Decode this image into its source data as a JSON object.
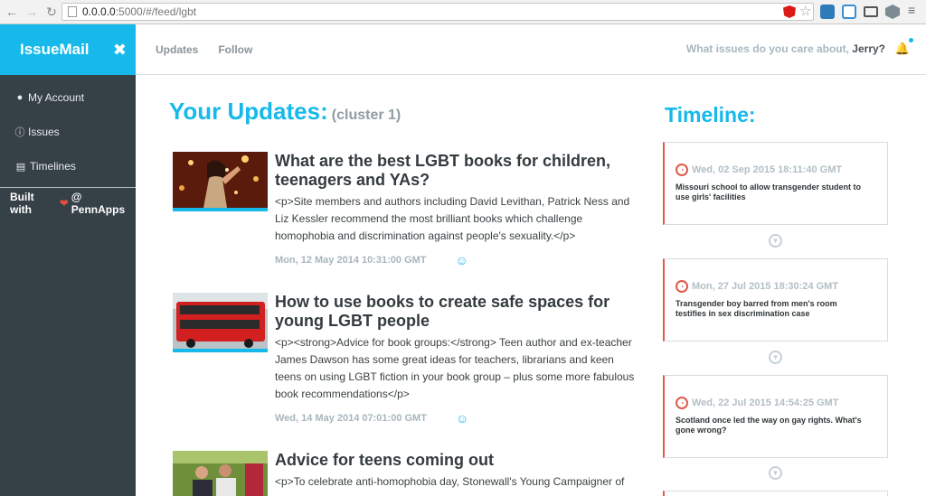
{
  "browser": {
    "url_host": "0.0.0.0",
    "url_path": ":5000/#/feed/lgbt"
  },
  "sidebar": {
    "brand": "IssueMail",
    "items": [
      {
        "label": "My Account",
        "icon": "user-icon"
      },
      {
        "label": "Issues",
        "icon": "info-icon"
      },
      {
        "label": "Timelines",
        "icon": "newspaper-icon"
      }
    ],
    "built_prefix": "Built with",
    "built_suffix": "@ PennApps"
  },
  "topnav": {
    "links": [
      "Updates",
      "Follow"
    ],
    "prompt": "What issues do you care about,",
    "user": "Jerry?"
  },
  "feed": {
    "title": "Your Updates:",
    "cluster": "(cluster 1)",
    "posts": [
      {
        "title": "What are the best LGBT books for children, teenagers and YAs?",
        "description": "<p>Site members and authors including David Levithan, Patrick Ness and Liz Kessler recommend the most brilliant books which challenge homophobia and discrimination against people's sexuality.</p>",
        "date": "Mon, 12 May 2014 10:31:00 GMT"
      },
      {
        "title": "How to use books to create safe spaces for young LGBT people",
        "description": "<p><strong>Advice for book groups:</strong> Teen author and ex-teacher James Dawson has some great ideas for teachers, librarians and keen teens on using LGBT fiction in your book group – plus some more fabulous book recommendations</p>",
        "date": "Wed, 14 May 2014 07:01:00 GMT"
      },
      {
        "title": "Advice for teens coming out",
        "description": "<p>To celebrate anti-homophobia day, Stonewall's Young Campaigner of",
        "date": ""
      }
    ]
  },
  "timeline": {
    "title": "Timeline:",
    "events": [
      {
        "date": "Wed, 02 Sep 2015 18:11:40 GMT",
        "headline": "Missouri school to allow transgender student to use girls' facilities"
      },
      {
        "date": "Mon, 27 Jul 2015 18:30:24 GMT",
        "headline": "Transgender boy barred from men's room testifies in sex discrimination case"
      },
      {
        "date": "Wed, 22 Jul 2015 14:54:25 GMT",
        "headline": "Scotland once led the way on gay rights. What's gone wrong?"
      }
    ]
  },
  "colors": {
    "accent": "#16b9ea",
    "sidebar": "#364047",
    "timeline_border": "#e0584c"
  }
}
